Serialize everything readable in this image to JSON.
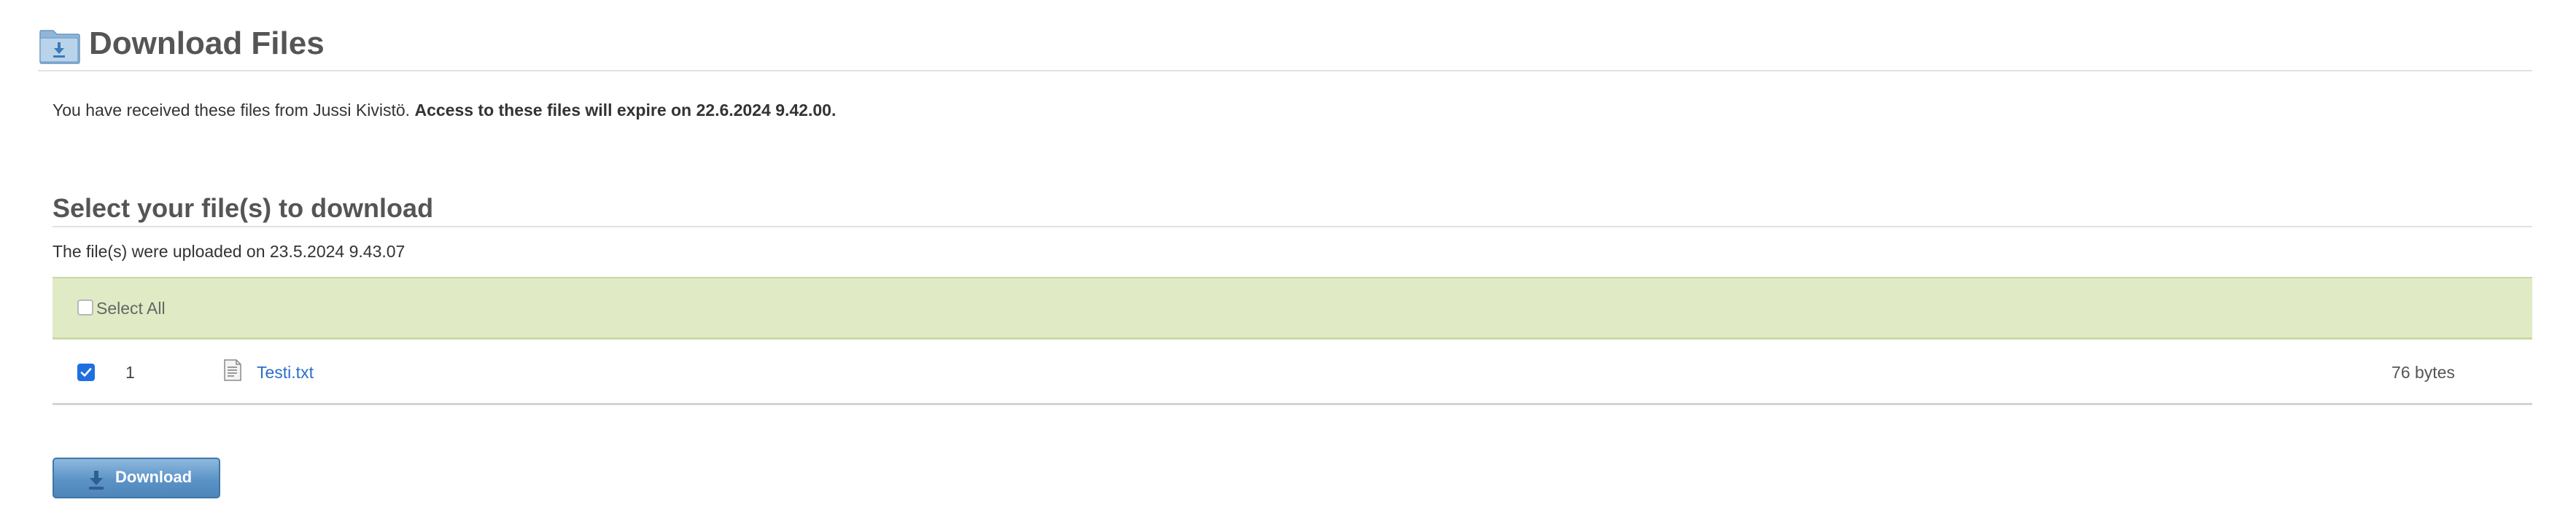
{
  "header": {
    "title": "Download Files",
    "icon": "folder-download-icon"
  },
  "notice": {
    "text": "You have received these files from Jussi Kivistö. ",
    "expiry": "Access to these files will expire on 22.6.2024 9.42.00."
  },
  "section": {
    "title": "Select your file(s) to download",
    "uploaded": "The file(s) were uploaded on 23.5.2024 9.43.07"
  },
  "select_all": {
    "label": "Select All",
    "checked": false
  },
  "files": [
    {
      "index": "1",
      "name": "Testi.txt",
      "size": "76 bytes",
      "checked": true,
      "icon": "text-file-icon"
    }
  ],
  "download_button": {
    "label": "Download",
    "icon": "download-arrow-icon"
  },
  "colors": {
    "select_bar_bg": "#e0ebc5",
    "link": "#2a6fc9",
    "button": "#5b93c7",
    "checkbox": "#1f6fe0"
  }
}
